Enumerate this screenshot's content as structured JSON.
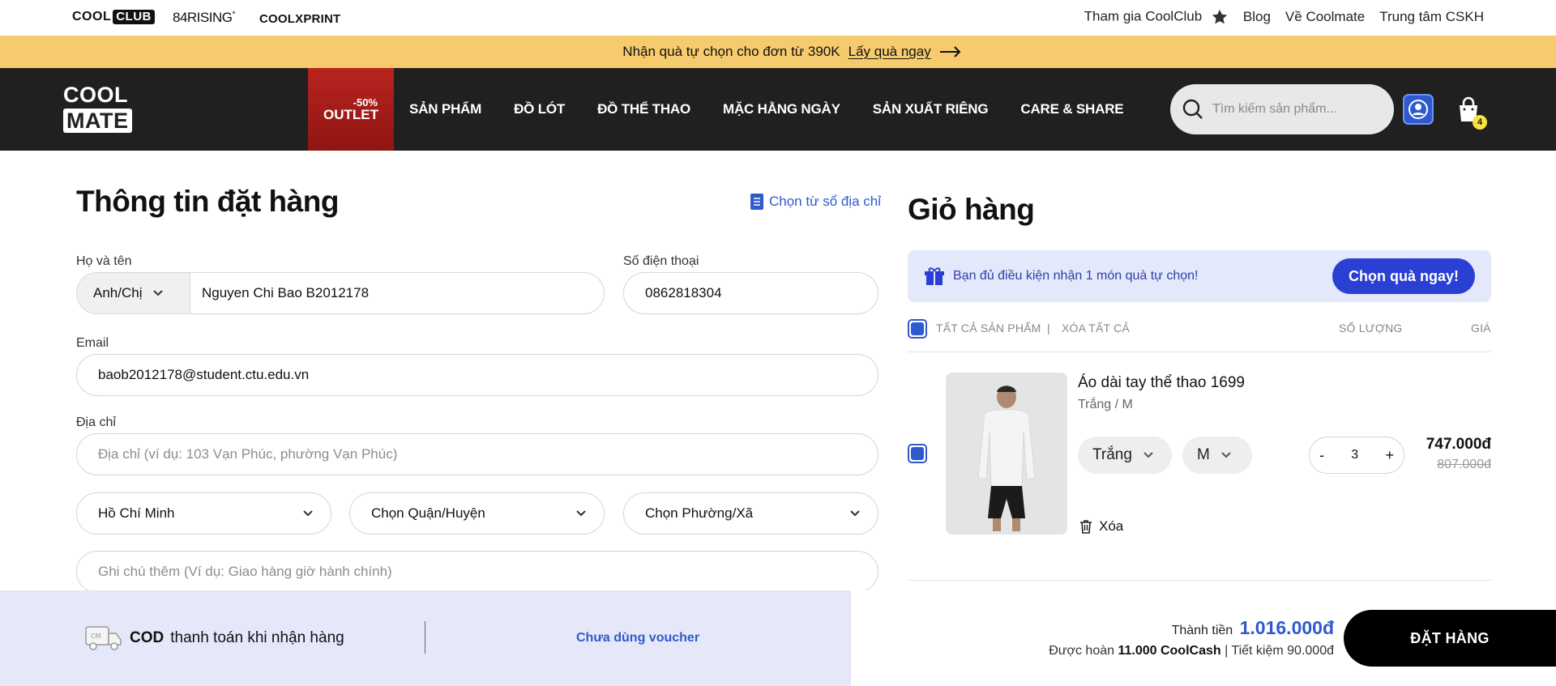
{
  "topbar": {
    "brands": {
      "coolclub_a": "COOL",
      "coolclub_b": "CLUB",
      "rising": "84RISING",
      "rising_mark": "*",
      "coolxprint": "COOLXPRINT"
    },
    "links": {
      "join": "Tham gia CoolClub",
      "blog": "Blog",
      "about": "Về Coolmate",
      "support": "Trung tâm CSKH"
    }
  },
  "promo": {
    "text": "Nhận quà tự chọn cho đơn từ 390K",
    "link": "Lấy quà ngay"
  },
  "nav": {
    "logo_l1": "COOL",
    "logo_l2": "MATE",
    "outlet_pct": "-50%",
    "outlet_label": "OUTLET",
    "items": [
      "SẢN PHẨM",
      "ĐỒ LÓT",
      "ĐỒ THỂ THAO",
      "MẶC HẰNG NGÀY",
      "SẢN XUẤT RIÊNG",
      "CARE & SHARE"
    ],
    "search_placeholder": "Tìm kiếm sản phẩm...",
    "cart_count": "4"
  },
  "form": {
    "title": "Thông tin đặt hàng",
    "address_book": "Chọn từ sổ địa chỉ",
    "name_label": "Họ và tên",
    "salutation": "Anh/Chị",
    "name_value": "Nguyen Chi Bao B2012178",
    "phone_label": "Số điện thoại",
    "phone_value": "0862818304",
    "email_label": "Email",
    "email_value": "baob2012178@student.ctu.edu.vn",
    "address_label": "Địa chỉ",
    "address_placeholder": "Địa chỉ (ví dụ: 103 Vạn Phúc, phường Vạn Phúc)",
    "city": "Hồ Chí Minh",
    "district": "Chọn Quận/Huyện",
    "ward": "Chọn Phường/Xã",
    "note_placeholder": "Ghi chú thêm (Ví dụ: Giao hàng giờ hành chính)"
  },
  "cart": {
    "title": "Giỏ hàng",
    "gift_text": "Bạn đủ điều kiện nhận 1 món quà tự chọn!",
    "gift_button": "Chọn quà ngay!",
    "col_all": "TẤT CẢ SẢN PHẨM",
    "col_sep": "|",
    "col_clear": "XÓA TẤT CẢ",
    "col_qty": "SỐ LƯỢNG",
    "col_price": "GIÁ",
    "item": {
      "name": "Áo dài tay thể thao 1699",
      "variant": "Trắng / M",
      "color": "Trắng",
      "size": "M",
      "qty_minus": "-",
      "qty": "3",
      "qty_plus": "+",
      "price": "747.000đ",
      "price_old": "807.000đ",
      "remove": "Xóa"
    }
  },
  "bottom": {
    "cod_bold": "COD",
    "cod_text": "thanh toán khi nhận hàng",
    "voucher": "Chưa dùng voucher",
    "total_label": "Thành tiền",
    "total_value": "1.016.000đ",
    "refund_prefix": "Được hoàn",
    "refund_value": "11.000 CoolCash",
    "refund_suffix": "| Tiết kiệm 90.000đ",
    "order_button": "ĐẶT HÀNG"
  },
  "colors": {
    "accent_blue": "#2f5acf",
    "promo_yellow": "#f5cb6e",
    "nav_dark": "#202020",
    "outlet_red": "#b8241f"
  }
}
